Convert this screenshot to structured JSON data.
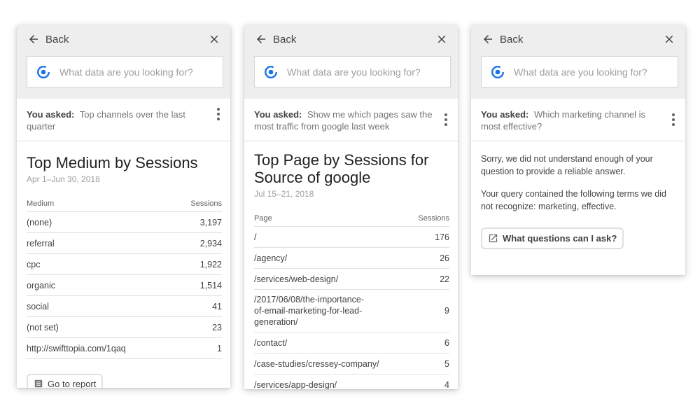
{
  "colors": {
    "accent": "#1a73e8",
    "header_bg": "#eeeeee",
    "border": "#e0e0e0"
  },
  "icons": {
    "back": "arrow-left-icon",
    "close": "close-icon",
    "logo": "analytics-insights-icon",
    "menu": "more-vert-icon",
    "report": "report-icon",
    "open": "open-in-new-icon"
  },
  "panels": [
    {
      "back_label": "Back",
      "search_placeholder": "What data are you looking for?",
      "asked_label": "You asked:",
      "asked_text": "Top channels over the last quarter",
      "title": "Top Medium by Sessions",
      "date": "Apr 1–Jun 30, 2018",
      "columns": [
        "Medium",
        "Sessions"
      ],
      "rows": [
        [
          "(none)",
          "3,197"
        ],
        [
          "referral",
          "2,934"
        ],
        [
          "cpc",
          "1,922"
        ],
        [
          "organic",
          "1,514"
        ],
        [
          "social",
          "41"
        ],
        [
          "(not set)",
          "23"
        ],
        [
          "http://swifttopia.com/1qaq",
          "1"
        ]
      ],
      "report_button": "Go to report"
    },
    {
      "back_label": "Back",
      "search_placeholder": "What data are you looking for?",
      "asked_label": "You asked:",
      "asked_text": "Show me which pages saw the most traffic from google last week",
      "title": "Top Page by Sessions for Source of google",
      "date": "Jul 15–21, 2018",
      "columns": [
        "Page",
        "Sessions"
      ],
      "rows": [
        [
          "/",
          "176"
        ],
        [
          "/agency/",
          "26"
        ],
        [
          "/services/web-design/",
          "22"
        ],
        [
          "/2017/06/08/the-importance-of-email-marketing-for-lead-generation/",
          "9"
        ],
        [
          "/contact/",
          "6"
        ],
        [
          "/case-studies/cressey-company/",
          "5"
        ],
        [
          "/services/app-design/",
          "4"
        ]
      ]
    },
    {
      "back_label": "Back",
      "search_placeholder": "What data are you looking for?",
      "asked_label": "You asked:",
      "asked_text": "Which marketing channel is most effective?",
      "message_1": "Sorry, we did not understand enough of your question to provide a reliable answer.",
      "message_2": "Your query contained the following terms we did not recognize: marketing, effective.",
      "questions_button": "What questions can I ask?"
    }
  ]
}
